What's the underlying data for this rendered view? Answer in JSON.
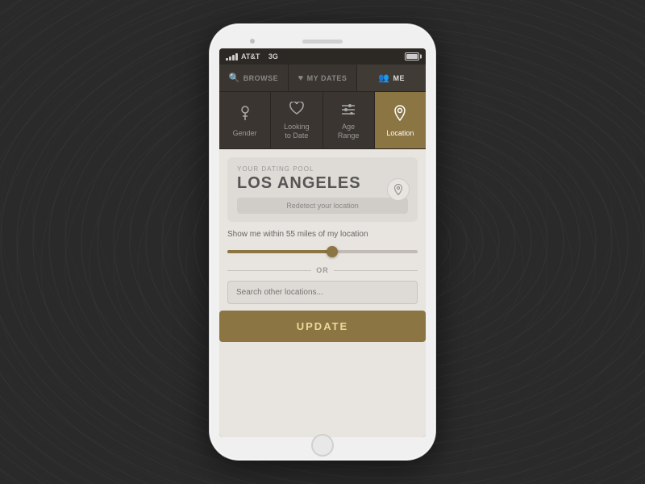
{
  "status_bar": {
    "carrier": "AT&T",
    "network": "3G"
  },
  "nav_tabs": [
    {
      "id": "browse",
      "label": "BROWSE",
      "icon": "🔍",
      "active": false
    },
    {
      "id": "my_dates",
      "label": "MY DATES",
      "icon": "♥",
      "active": false
    },
    {
      "id": "me",
      "label": "ME",
      "icon": "👥",
      "active": true
    }
  ],
  "filter_tiles": [
    {
      "id": "gender",
      "label": "Gender",
      "icon": "👤",
      "active": false
    },
    {
      "id": "looking_to_date",
      "label": "Looking\nto Date",
      "icon": "♥",
      "active": false
    },
    {
      "id": "age_range",
      "label": "Age\nRange",
      "icon": "≡",
      "active": false
    },
    {
      "id": "location",
      "label": "Location",
      "icon": "📍",
      "active": true
    }
  ],
  "dating_pool": {
    "label": "YOUR DATING POOL",
    "city": "LOS ANGELES",
    "redetect_label": "Redetect your location",
    "pin_icon": "📍"
  },
  "range": {
    "label_prefix": "Show me within ",
    "miles": "55",
    "label_suffix": " miles of my location",
    "percent": 55
  },
  "or_divider": "OR",
  "search": {
    "placeholder": "Search other locations..."
  },
  "update_button": "UPDATE"
}
